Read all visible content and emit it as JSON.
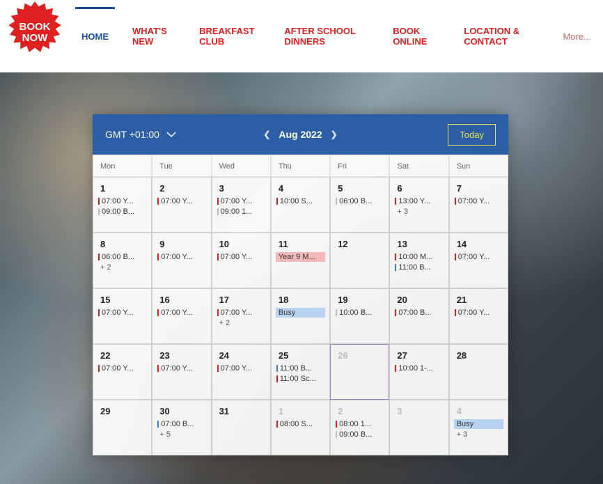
{
  "badge": {
    "line1": "BOOK",
    "line2": "NOW"
  },
  "nav": {
    "items": [
      {
        "label": "HOME",
        "active": true
      },
      {
        "label": "WHAT'S NEW"
      },
      {
        "label": "BREAKFAST CLUB"
      },
      {
        "label": "AFTER SCHOOL DINNERS"
      },
      {
        "label": "BOOK ONLINE"
      },
      {
        "label": "LOCATION & CONTACT"
      },
      {
        "label": "More...",
        "more": true
      }
    ]
  },
  "calendar": {
    "timezone": "GMT +01:00",
    "month_label": "Aug 2022",
    "today_label": "Today",
    "day_headers": [
      "Mon",
      "Tue",
      "Wed",
      "Thu",
      "Fri",
      "Sat",
      "Sun"
    ],
    "cells": [
      {
        "num": "1",
        "events": [
          {
            "t": "07:00 Y...",
            "c": "red"
          },
          {
            "t": "09:00 B...",
            "c": "gray"
          }
        ]
      },
      {
        "num": "2",
        "events": [
          {
            "t": "07:00 Y...",
            "c": "red"
          }
        ]
      },
      {
        "num": "3",
        "events": [
          {
            "t": "07:00 Y...",
            "c": "red"
          },
          {
            "t": "09:00 1...",
            "c": "gray"
          }
        ]
      },
      {
        "num": "4",
        "events": [
          {
            "t": "10:00 S...",
            "c": "red"
          }
        ]
      },
      {
        "num": "5",
        "events": [
          {
            "t": "06:00 B...",
            "c": "gray"
          }
        ]
      },
      {
        "num": "6",
        "events": [
          {
            "t": "13:00 Y...",
            "c": "red"
          }
        ],
        "more": "+ 3"
      },
      {
        "num": "7",
        "events": [
          {
            "t": "07:00 Y...",
            "c": "red"
          }
        ]
      },
      {
        "num": "8",
        "events": [
          {
            "t": "06:00 B...",
            "c": "red"
          }
        ],
        "more": "+ 2"
      },
      {
        "num": "9",
        "events": [
          {
            "t": "07:00 Y...",
            "c": "red"
          }
        ]
      },
      {
        "num": "10",
        "events": [
          {
            "t": "07:00 Y...",
            "c": "red"
          }
        ]
      },
      {
        "num": "11",
        "events": [
          {
            "t": "Year 9 M...",
            "c": "pink",
            "block": true
          }
        ]
      },
      {
        "num": "12",
        "events": []
      },
      {
        "num": "13",
        "events": [
          {
            "t": "10:00 M...",
            "c": "red"
          },
          {
            "t": "11:00 B...",
            "c": "blue"
          }
        ]
      },
      {
        "num": "14",
        "events": [
          {
            "t": "07:00 Y...",
            "c": "red"
          }
        ]
      },
      {
        "num": "15",
        "events": [
          {
            "t": "07:00 Y...",
            "c": "red"
          }
        ]
      },
      {
        "num": "16",
        "events": [
          {
            "t": "07:00 Y...",
            "c": "red"
          }
        ]
      },
      {
        "num": "17",
        "events": [
          {
            "t": "07:00 Y...",
            "c": "red"
          }
        ],
        "more": "+ 2"
      },
      {
        "num": "18",
        "events": [
          {
            "t": "Busy",
            "c": "lblue",
            "block": true
          }
        ]
      },
      {
        "num": "19",
        "events": [
          {
            "t": "10:00 B...",
            "c": "gray"
          }
        ]
      },
      {
        "num": "20",
        "events": [
          {
            "t": "07:00 B...",
            "c": "red"
          }
        ]
      },
      {
        "num": "21",
        "events": [
          {
            "t": "07:00 Y...",
            "c": "red"
          }
        ]
      },
      {
        "num": "22",
        "events": [
          {
            "t": "07:00 Y...",
            "c": "red"
          }
        ]
      },
      {
        "num": "23",
        "events": [
          {
            "t": "07:00 Y...",
            "c": "red"
          }
        ]
      },
      {
        "num": "24",
        "events": [
          {
            "t": "07:00 Y...",
            "c": "red"
          }
        ]
      },
      {
        "num": "25",
        "events": [
          {
            "t": "11:00 B...",
            "c": "blue"
          },
          {
            "t": "11:00 Sc...",
            "c": "red"
          }
        ]
      },
      {
        "num": "26",
        "today": true,
        "muted": true,
        "events": []
      },
      {
        "num": "27",
        "events": [
          {
            "t": "10:00 1-...",
            "c": "red"
          }
        ]
      },
      {
        "num": "28",
        "events": []
      },
      {
        "num": "29",
        "events": []
      },
      {
        "num": "30",
        "events": [
          {
            "t": "07:00 B...",
            "c": "blue"
          }
        ],
        "more": "+ 5"
      },
      {
        "num": "31",
        "events": []
      },
      {
        "num": "1",
        "muted": true,
        "events": [
          {
            "t": "08:00 S...",
            "c": "red"
          }
        ]
      },
      {
        "num": "2",
        "muted": true,
        "events": [
          {
            "t": "08:00 1...",
            "c": "red"
          },
          {
            "t": "09:00 B...",
            "c": "gray"
          }
        ]
      },
      {
        "num": "3",
        "muted": true,
        "events": []
      },
      {
        "num": "4",
        "muted": true,
        "events": [
          {
            "t": "Busy",
            "c": "lblue",
            "block": true
          }
        ],
        "more": "+ 3"
      }
    ]
  },
  "colors": {
    "red": "#e02020",
    "blue": "#3a7bd5",
    "gray": "#bbb",
    "pink_bg": "#f4b9b9",
    "lblue_bg": "#b9d4f0"
  }
}
